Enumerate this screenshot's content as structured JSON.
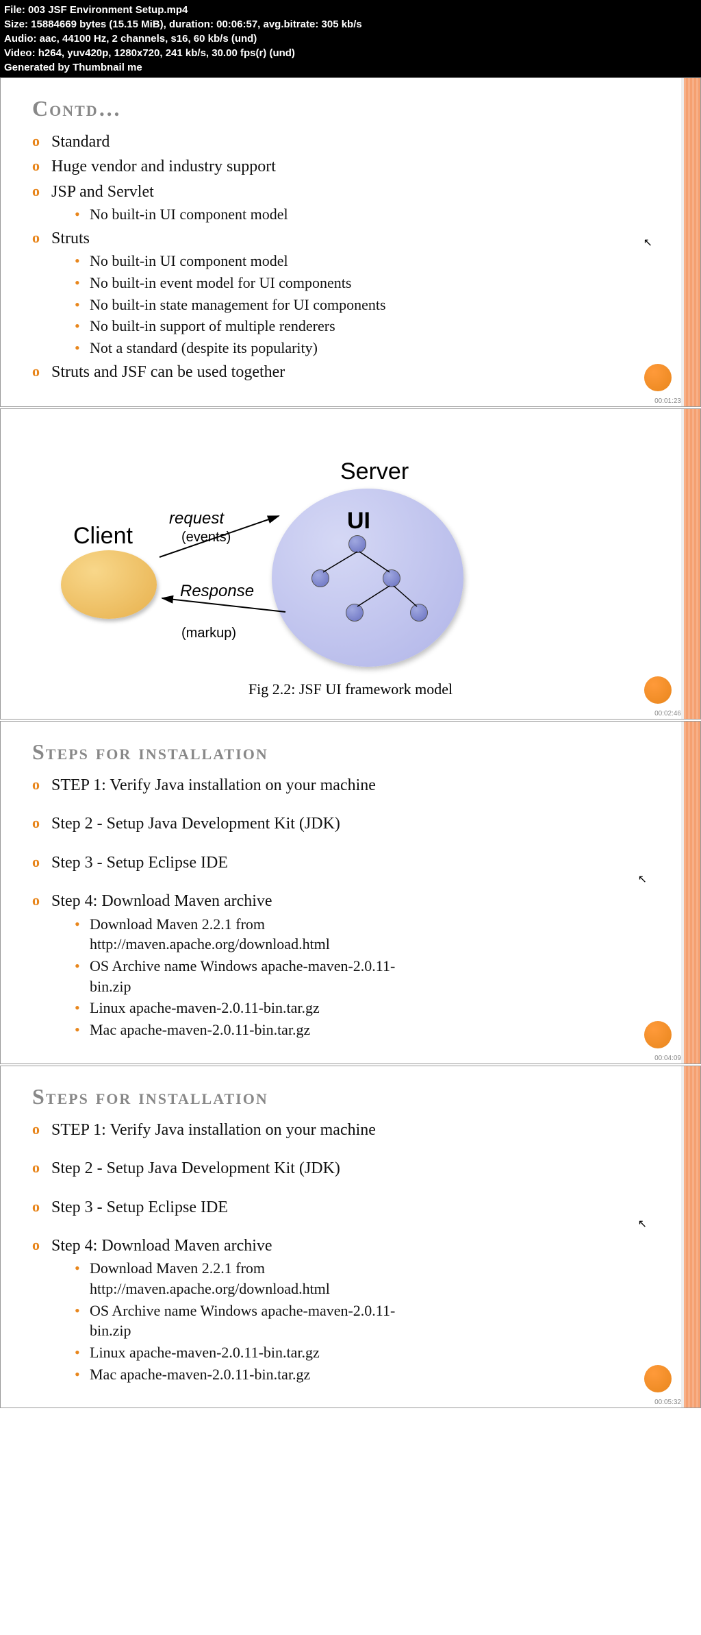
{
  "header": {
    "file": "File: 003 JSF Environment Setup.mp4",
    "size": "Size: 15884669 bytes (15.15 MiB), duration: 00:06:57, avg.bitrate: 305 kb/s",
    "audio": "Audio: aac, 44100 Hz, 2 channels, s16, 60 kb/s (und)",
    "video": "Video: h264, yuv420p, 1280x720, 241 kb/s, 30.00 fps(r) (und)",
    "gen": "Generated by Thumbnail me"
  },
  "slide1": {
    "title": "Contd…",
    "items": [
      "Standard",
      "Huge vendor and industry support",
      "JSP and Servlet",
      "No built-in UI component model",
      "Struts",
      "No built-in UI component model",
      "No built-in event model for UI components",
      "No built-in state management for UI components",
      "No built-in support of multiple renderers",
      "Not a standard (despite its popularity)",
      "Struts and JSF can be used together"
    ],
    "timestamp": "00:01:23"
  },
  "slide2": {
    "client": "Client",
    "server": "Server",
    "ui": "UI",
    "request": "request",
    "events": "(events)",
    "response": "Response",
    "markup": "(markup)",
    "caption": "Fig 2.2: JSF UI framework model",
    "timestamp": "00:02:46"
  },
  "slide3": {
    "title": "Steps for installation",
    "items": [
      "STEP 1: Verify Java installation on your machine",
      "Step 2 - Setup Java Development Kit (JDK)",
      "Step 3 - Setup Eclipse IDE",
      "Step 4: Download Maven archive",
      "Download Maven 2.2.1 from http://maven.apache.org/download.html",
      "OS Archive name Windows apache-maven-2.0.11-bin.zip",
      "Linux apache-maven-2.0.11-bin.tar.gz",
      "Mac apache-maven-2.0.11-bin.tar.gz"
    ],
    "timestamp": "00:04:09"
  },
  "slide4": {
    "title": "Steps for installation",
    "items": [
      "STEP 1: Verify Java installation on your machine",
      "Step 2 - Setup Java Development Kit (JDK)",
      "Step 3 - Setup Eclipse IDE",
      "Step 4: Download Maven archive",
      "Download Maven 2.2.1 from http://maven.apache.org/download.html",
      "OS Archive name Windows apache-maven-2.0.11-bin.zip",
      "Linux apache-maven-2.0.11-bin.tar.gz",
      "Mac apache-maven-2.0.11-bin.tar.gz"
    ],
    "timestamp": "00:05:32"
  }
}
